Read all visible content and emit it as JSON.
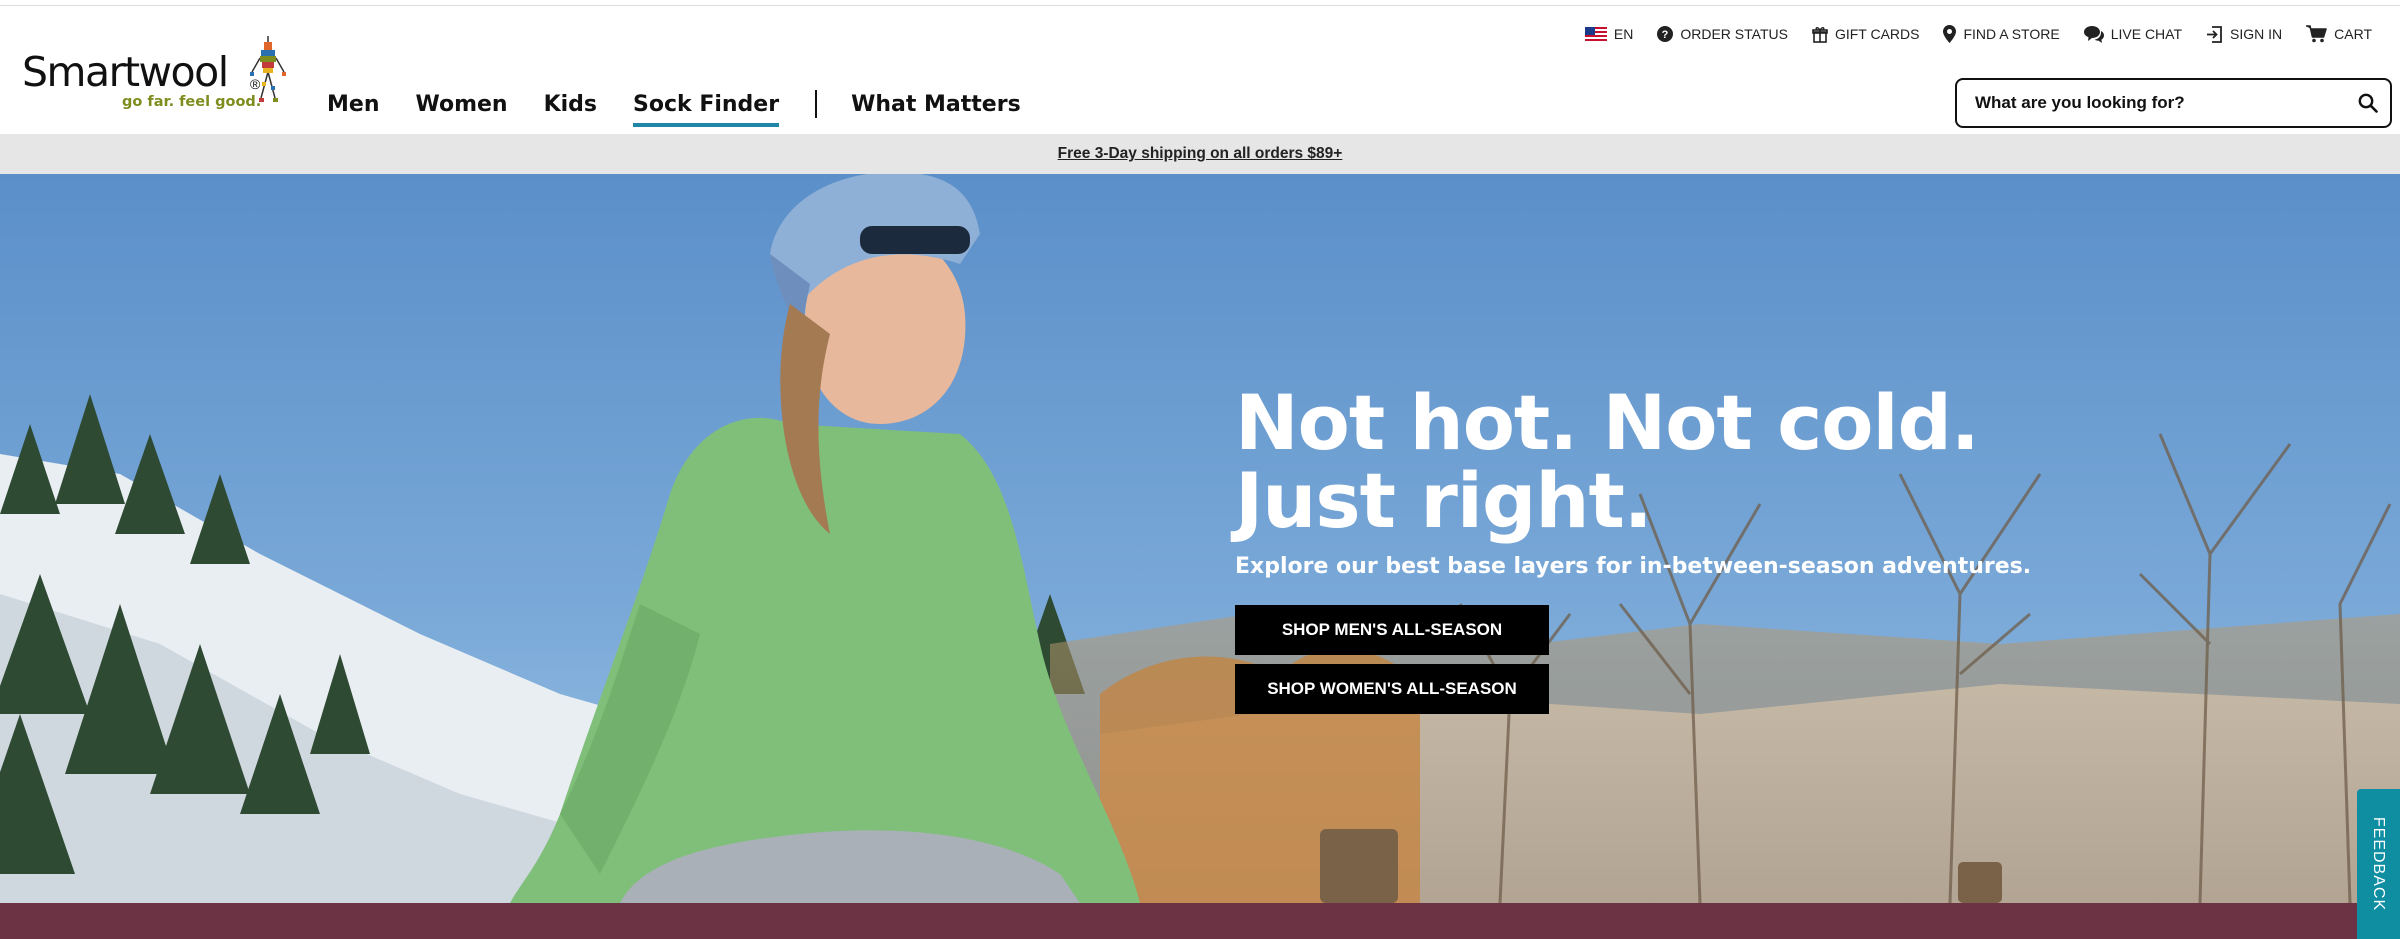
{
  "brand": {
    "name": "Smartwool",
    "tagline": "go far. feel good.",
    "registered_mark": "®"
  },
  "utility_nav": [
    {
      "label": "EN",
      "icon": "us-flag-icon"
    },
    {
      "label": "ORDER STATUS",
      "icon": "question-circle-icon"
    },
    {
      "label": "GIFT CARDS",
      "icon": "gift-icon"
    },
    {
      "label": "FIND A STORE",
      "icon": "map-pin-icon"
    },
    {
      "label": "LIVE CHAT",
      "icon": "chat-bubbles-icon"
    },
    {
      "label": "SIGN IN",
      "icon": "sign-in-icon"
    },
    {
      "label": "CART",
      "icon": "cart-icon"
    }
  ],
  "main_nav": {
    "items": [
      "Men",
      "Women",
      "Kids",
      "Sock Finder"
    ],
    "active": "Sock Finder",
    "secondary": "What Matters"
  },
  "search": {
    "placeholder": "What are you looking for?",
    "value": ""
  },
  "promo": {
    "text": "Free 3-Day shipping on all orders $89+"
  },
  "hero": {
    "title_line1": "Not hot. Not cold.",
    "title_line2": "Just right.",
    "subtitle": "Explore our best base layers for in-between-season adventures.",
    "cta_men": "SHOP MEN'S ALL-SEASON",
    "cta_women": "SHOP WOMEN'S ALL-SEASON"
  },
  "feedback": {
    "label": "FEEDBACK"
  },
  "colors": {
    "accent_underline": "#1f86a6",
    "promo_bg": "#e6e6e6",
    "bottom_band": "#6b3344",
    "feedback_tab": "#0f8ea2",
    "tagline": "#7f8c1e"
  }
}
